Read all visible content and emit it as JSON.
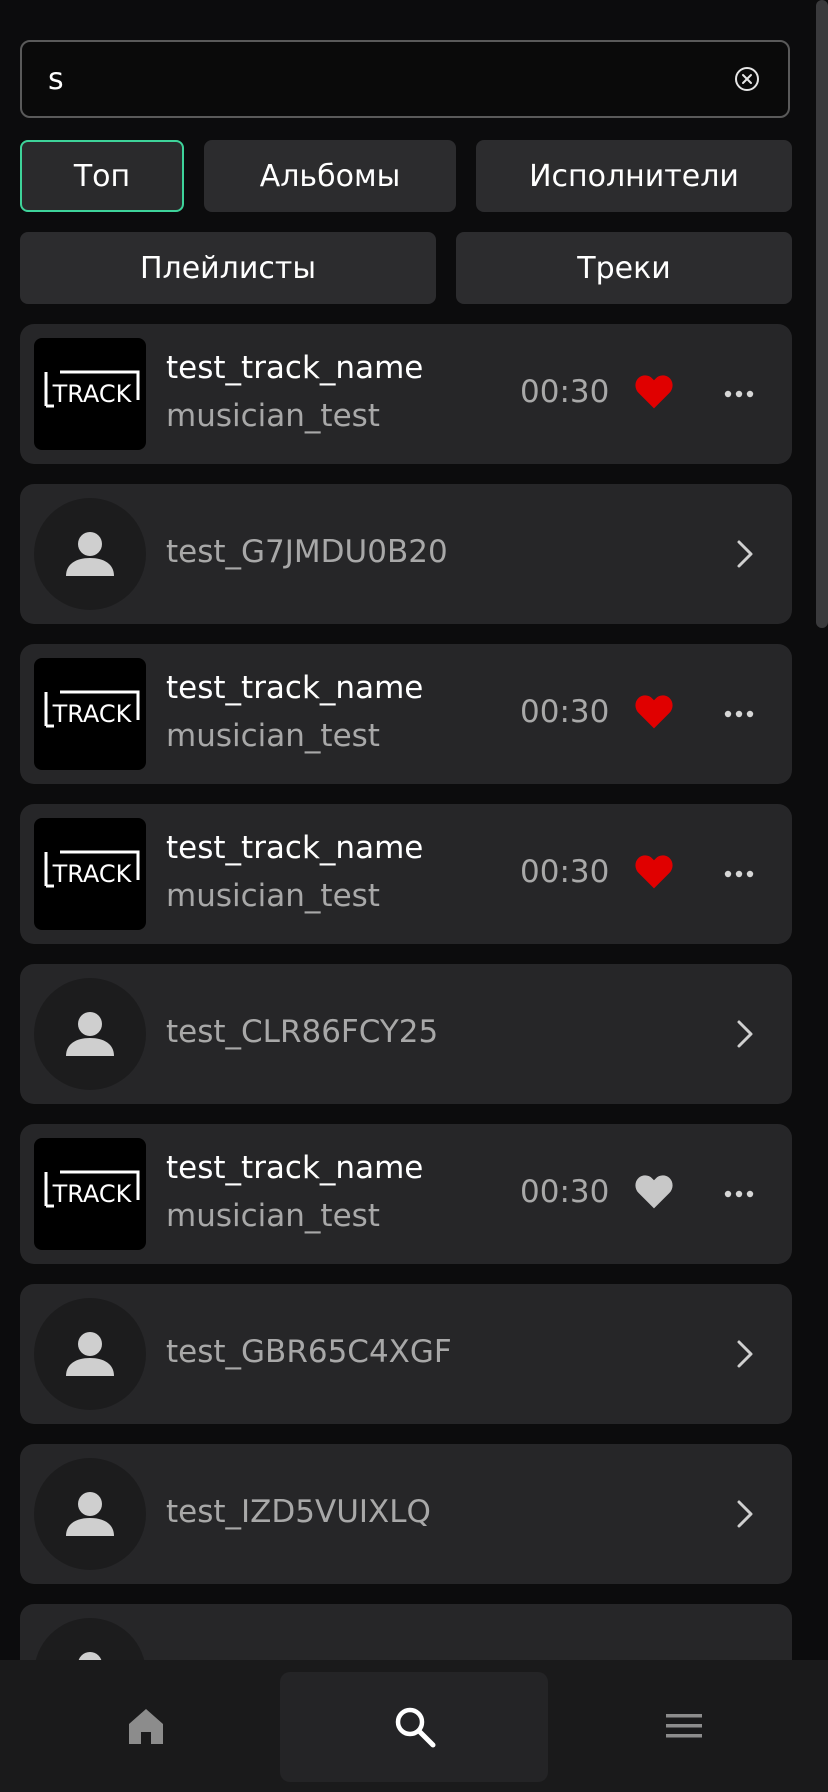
{
  "search": {
    "value": "s",
    "placeholder": ""
  },
  "filters": {
    "top": "Топ",
    "albums": "Альбомы",
    "artists": "Исполнители",
    "playlists": "Плейлисты",
    "tracks": "Треки"
  },
  "results": [
    {
      "kind": "track",
      "title": "test_track_name",
      "artist": "musician_test",
      "duration": "00:30",
      "liked": true,
      "cover_text": "TRACK"
    },
    {
      "kind": "artist",
      "name": "test_G7JMDU0B20"
    },
    {
      "kind": "track",
      "title": "test_track_name",
      "artist": "musician_test",
      "duration": "00:30",
      "liked": true,
      "cover_text": "TRACK"
    },
    {
      "kind": "track",
      "title": "test_track_name",
      "artist": "musician_test",
      "duration": "00:30",
      "liked": true,
      "cover_text": "TRACK"
    },
    {
      "kind": "artist",
      "name": "test_CLR86FCY25"
    },
    {
      "kind": "track",
      "title": "test_track_name",
      "artist": "musician_test",
      "duration": "00:30",
      "liked": false,
      "cover_text": "TRACK"
    },
    {
      "kind": "artist",
      "name": "test_GBR65C4XGF"
    },
    {
      "kind": "artist",
      "name": "test_IZD5VUIXLQ"
    },
    {
      "kind": "artist",
      "name": ""
    }
  ],
  "icons": {
    "clear": "clear-circle-icon",
    "liked": "heart-filled-icon",
    "more": "more-horizontal-icon",
    "open": "chevron-right-icon",
    "avatar": "person-icon",
    "home": "home-icon",
    "search": "search-icon",
    "menu": "menu-icon"
  },
  "colors": {
    "background": "#0c0c0d",
    "card": "#262628",
    "accent": "#3ed39a",
    "liked": "#e00000",
    "unliked": "#c8c8c8",
    "secondary_text": "#a8a8a8"
  },
  "bottom_nav": {
    "active": "search"
  }
}
